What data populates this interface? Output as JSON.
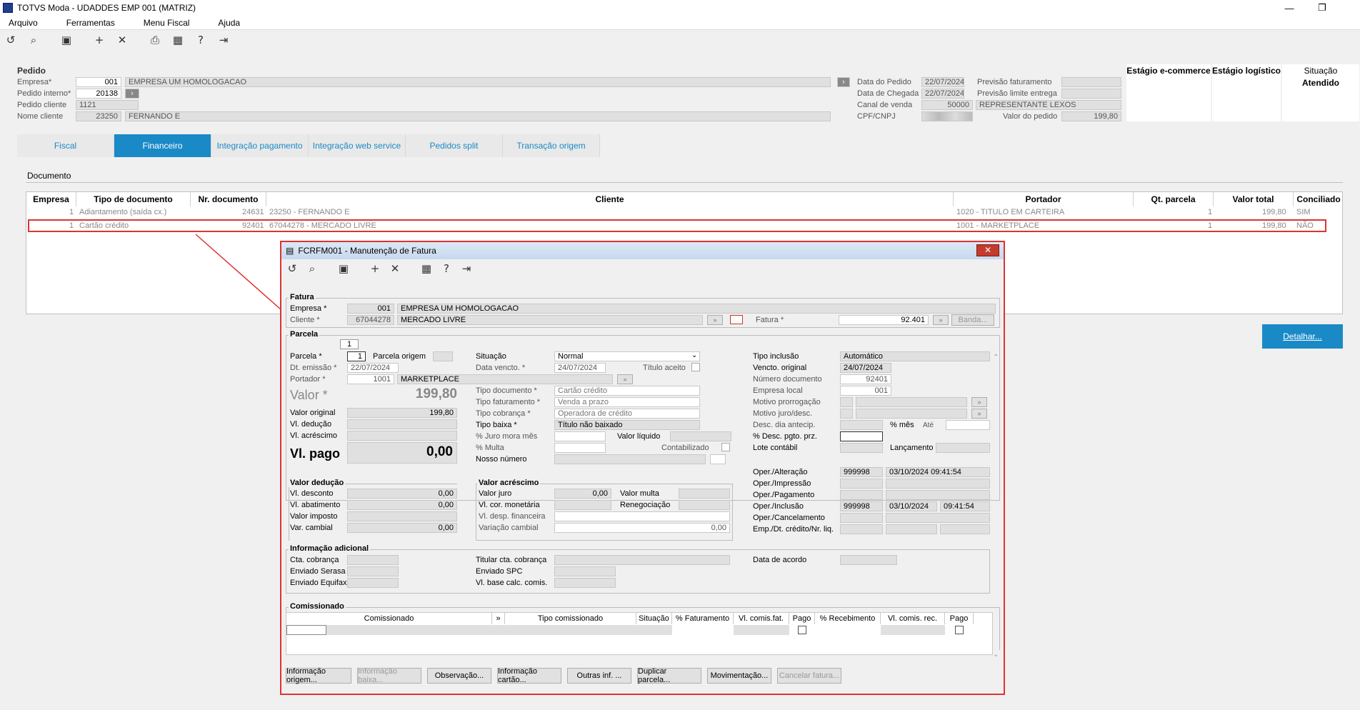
{
  "window": {
    "title": "TOTVS Moda - UDADDES EMP 001 (MATRIZ)",
    "minimize": "—",
    "restore": "❐"
  },
  "menu": [
    "Arquivo",
    "Ferramentas",
    "Menu Fiscal",
    "Ajuda"
  ],
  "toolbar_icons": [
    "undo-icon",
    "search-icon",
    "save-icon",
    "add-icon",
    "cancel-icon",
    "print-icon",
    "calendar-icon",
    "help-icon",
    "exit-icon"
  ],
  "pedido": {
    "section": "Pedido",
    "empresa_label": "Empresa*",
    "empresa_code": "001",
    "empresa_name": "EMPRESA UM HOMOLOGACAO",
    "pedido_interno_label": "Pedido interno*",
    "pedido_interno": "20138",
    "pedido_cliente_label": "Pedido cliente",
    "pedido_cliente": "1121",
    "nome_cliente_label": "Nome cliente",
    "cliente_code": "23250",
    "cliente_name": "FERNANDO E",
    "data_pedido_label": "Data do Pedido",
    "data_pedido": "22/07/2024",
    "data_chegada_label": "Data de Chegada",
    "data_chegada": "22/07/2024",
    "canal_venda_label": "Canal de venda",
    "canal_venda": "50000",
    "canal_venda_name": "REPRESENTANTE LEXOS",
    "cpf_label": "CPF/CNPJ",
    "cpf": "",
    "prev_fat_label": "Previsão faturamento",
    "prev_limite_label": "Previsão limite entrega",
    "valor_pedido_label": "Valor do pedido",
    "valor_pedido": "199,80",
    "estagio_ecommerce": "Estágio e-commerce",
    "estagio_logistico": "Estágio logístico",
    "situacao_label": "Situação",
    "situacao": "Atendido"
  },
  "tabs": [
    "Fiscal",
    "Financeiro",
    "Integração pagamento",
    "Integração web service",
    "Pedidos split",
    "Transação origem"
  ],
  "documento": {
    "title": "Documento",
    "headers": [
      "Empresa",
      "Tipo de documento",
      "Nr. documento",
      "Cliente",
      "Portador",
      "Qt. parcela",
      "Valor total",
      "Conciliado"
    ],
    "rows": [
      [
        "1",
        "Adiantamento (saída cx.)",
        "24631",
        "23250 - FERNANDO E",
        "1020 - TITULO EM CARTEIRA",
        "1",
        "199,80",
        "SIM"
      ],
      [
        "1",
        "Cartão crédito",
        "92401",
        "67044278 - MERCADO LIVRE",
        "1001 - MARKETPLACE",
        "1",
        "199,80",
        "NÃO"
      ]
    ],
    "detalhar": "Detalhar..."
  },
  "dialog": {
    "title": "FCRFM001 - Manutenção de Fatura",
    "close": "✕",
    "fatura": {
      "title": "Fatura",
      "empresa_label": "Empresa *",
      "empresa_code": "001",
      "empresa_name": "EMPRESA UM HOMOLOGACAO",
      "cliente_label": "Cliente *",
      "cliente_code": "67044278",
      "cliente_name": "MERCADO LIVRE",
      "fatura_label": "Fatura *",
      "fatura": "92.401",
      "banda": "Banda..."
    },
    "parcela": {
      "title": "Parcela",
      "tab": "1",
      "parcela_label": "Parcela *",
      "parcela": "1",
      "parcela_origem_label": "Parcela origem",
      "dt_emissao_label": "Dt. emissão *",
      "dt_emissao": "22/07/2024",
      "portador_label": "Portador *",
      "portador_code": "1001",
      "portador_name": "MARKETPLACE",
      "valor_label": "Valor *",
      "valor": "199,80",
      "valor_original_label": "Valor original",
      "valor_original": "199,80",
      "vl_deducao_label": "Vl. dedução",
      "vl_acrescimo_label": "Vl. acréscimo",
      "vl_pago_label": "Vl. pago",
      "vl_pago": "0,00",
      "situacao_label": "Situação",
      "situacao": "Normal",
      "data_vencto_label": "Data vencto. *",
      "data_vencto": "24/07/2024",
      "titulo_aceito_label": "Título aceito",
      "tipo_documento_label": "Tipo documento *",
      "tipo_documento": "Cartão crédito",
      "tipo_faturamento_label": "Tipo faturamento *",
      "tipo_faturamento": "Venda a prazo",
      "tipo_cobranca_label": "Tipo cobrança *",
      "tipo_cobranca": "Operadora de crédito",
      "tipo_baixa_label": "Tipo baixa *",
      "tipo_baixa": "Título não baixado",
      "juro_mora_label": "% Juro mora mês",
      "valor_liquido_label": "Valor líquido",
      "multa_label": "% Multa",
      "contabilizado_label": "Contabilizado",
      "nosso_numero_label": "Nosso número",
      "tipo_inclusao_label": "Tipo inclusão",
      "tipo_inclusao": "Automático",
      "vencto_original_label": "Vencto. original",
      "vencto_original": "24/07/2024",
      "numero_documento_label": "Número documento",
      "numero_documento": "92401",
      "empresa_local_label": "Empresa local",
      "empresa_local": "001",
      "motivo_prorrogacao_label": "Motivo prorrogação",
      "motivo_juro_label": "Motivo juro/desc.",
      "desc_dia_label": "Desc. dia antecip.",
      "pct_mes": "% mês",
      "ate": "Até",
      "desc_pgto_label": "% Desc. pgto. prz.",
      "lote_label": "Lote contábil",
      "lancamento_label": "Lançamento"
    },
    "deducao": {
      "title": "Valor dedução",
      "desconto_label": "Vl. desconto",
      "desconto": "0,00",
      "abatimento_label": "Vl. abatimento",
      "abatimento": "0,00",
      "imposto_label": "Valor imposto",
      "var_cambial_label": "Var. cambial",
      "var_cambial": "0,00"
    },
    "acrescimo": {
      "title": "Valor acréscimo",
      "juro_label": "Valor juro",
      "juro": "0,00",
      "multa_label": "Valor multa",
      "cor_label": "Vl. cor. monetária",
      "reneg_label": "Renegociação",
      "desp_label": "Vl. desp. financeira",
      "variacao_label": "Variação cambial",
      "variacao": "0,00"
    },
    "oper": {
      "alteracao_label": "Oper./Alteração",
      "alt_user": "999998",
      "alt_date": "03/10/2024 09:41:54",
      "impressao_label": "Oper./Impressão",
      "pagamento_label": "Oper./Pagamento",
      "inclusao_label": "Oper./Inclusão",
      "inc_user": "999998",
      "inc_date": "03/10/2024",
      "inc_time": "09:41:54",
      "cancelamento_label": "Oper./Cancelamento",
      "emp_label": "Emp./Dt. crédito/Nr. liq."
    },
    "info": {
      "title": "Informação adicional",
      "cta_label": "Cta. cobrança",
      "serasa_label": "Enviado Serasa",
      "equifax_label": "Enviado Equifax",
      "titular_label": "Titular cta. cobrança",
      "spc_label": "Enviado SPC",
      "base_label": "Vl. base calc. comis.",
      "data_acordo_label": "Data de acordo"
    },
    "comissionado": {
      "title": "Comissionado",
      "headers": [
        "Comissionado",
        "»",
        "Tipo comissionado",
        "Situação",
        "% Faturamento",
        "Vl. comis.fat.",
        "Pago",
        "% Recebimento",
        "Vl. comis. rec.",
        "Pago"
      ]
    },
    "buttons": [
      "Informação origem...",
      "Informação baixa...",
      "Observação...",
      "Informação cartão...",
      "Outras inf. ...",
      "Duplicar parcela...",
      "Movimentação...",
      "Cancelar fatura..."
    ]
  }
}
